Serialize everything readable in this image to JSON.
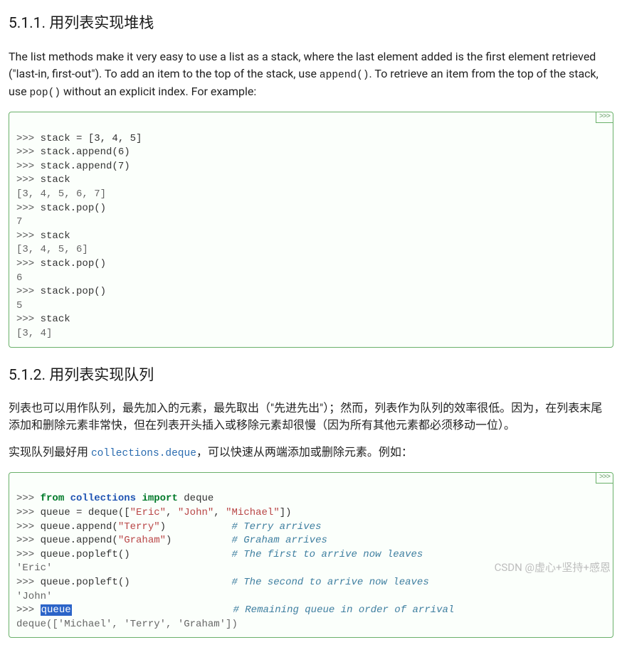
{
  "sec1": {
    "heading": "5.1.1. 用列表实现堆栈",
    "p1_a": "The list methods make it very easy to use a list as a stack, where the last element added is the first element retrieved (\"last-in, first-out\"). To add an item to the top of the stack, use ",
    "code_append": "append()",
    "p1_b": ". To retrieve an item from the top of the stack, use ",
    "code_pop": "pop()",
    "p1_c": " without an explicit index. For example:"
  },
  "code1": {
    "copy": ">>>",
    "l1_prompt": ">>> ",
    "l1_text": "stack = [3, 4, 5]",
    "l2_prompt": ">>> ",
    "l2_text": "stack.append(6)",
    "l3_prompt": ">>> ",
    "l3_text": "stack.append(7)",
    "l4_prompt": ">>> ",
    "l4_text": "stack",
    "l5_out": "[3, 4, 5, 6, 7]",
    "l6_prompt": ">>> ",
    "l6_text": "stack.pop()",
    "l7_out": "7",
    "l8_prompt": ">>> ",
    "l8_text": "stack",
    "l9_out": "[3, 4, 5, 6]",
    "l10_prompt": ">>> ",
    "l10_text": "stack.pop()",
    "l11_out": "6",
    "l12_prompt": ">>> ",
    "l12_text": "stack.pop()",
    "l13_out": "5",
    "l14_prompt": ">>> ",
    "l14_text": "stack",
    "l15_out": "[3, 4]"
  },
  "sec2": {
    "heading": "5.1.2. 用列表实现队列",
    "p1": "列表也可以用作队列，最先加入的元素，最先取出（\"先进先出\"）；然而，列表作为队列的效率很低。因为，在列表末尾添加和删除元素非常快，但在列表开头插入或移除元素却很慢（因为所有其他元素都必须移动一位）。",
    "p2_a": "实现队列最好用 ",
    "link": "collections.deque",
    "p2_b": "，可以快速从两端添加或删除元素。例如：",
    "link_href": "#"
  },
  "code2": {
    "copy": ">>>",
    "l1_prompt": ">>> ",
    "l1_from": "from",
    "l1_mod": "collections",
    "l1_import": "import",
    "l1_name": " deque",
    "l2_prompt": ">>> ",
    "l2_a": "queue = deque([",
    "l2_s1": "\"Eric\"",
    "l2_c1": ", ",
    "l2_s2": "\"John\"",
    "l2_c2": ", ",
    "l2_s3": "\"Michael\"",
    "l2_b": "])",
    "l3_prompt": ">>> ",
    "l3_a": "queue.append(",
    "l3_s": "\"Terry\"",
    "l3_b": ")",
    "l3_pad": "           ",
    "l3_cmt": "# Terry arrives",
    "l4_prompt": ">>> ",
    "l4_a": "queue.append(",
    "l4_s": "\"Graham\"",
    "l4_b": ")",
    "l4_pad": "          ",
    "l4_cmt": "# Graham arrives",
    "l5_prompt": ">>> ",
    "l5_a": "queue.popleft()",
    "l5_pad": "                 ",
    "l5_cmt": "# The first to arrive now leaves",
    "l6_out": "'Eric'",
    "l7_prompt": ">>> ",
    "l7_a": "queue.popleft()",
    "l7_pad": "                 ",
    "l7_cmt": "# The second to arrive now leaves",
    "l8_out": "'John'",
    "l9_prompt": ">>> ",
    "l9_hl": "queue",
    "l9_pad": "                           ",
    "l9_cmt": "# Remaining queue in order of arrival",
    "l10_out": "deque(['Michael', 'Terry', 'Graham'])"
  },
  "watermark": "CSDN @虚心+坚持+感恩"
}
